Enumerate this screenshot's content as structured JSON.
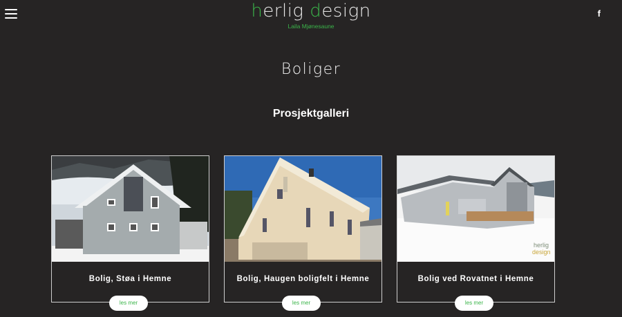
{
  "header": {
    "logo_part1": "h",
    "logo_part2": "erlig ",
    "logo_part3": "d",
    "logo_part4": "esign",
    "subtitle": "Laila Mjønesaune",
    "facebook_label": "f"
  },
  "page": {
    "title": "Boliger",
    "section_title": "Prosjektgalleri"
  },
  "cards": [
    {
      "title": "Bolig, Støa i Hemne",
      "button": "les mer"
    },
    {
      "title": "Bolig, Haugen boligfelt i Hemne",
      "button": "les mer"
    },
    {
      "title": "Bolig ved Rovatnet i Hemne",
      "button": "les mer"
    }
  ],
  "colors": {
    "background": "#262424",
    "accent": "#3bb54a"
  }
}
